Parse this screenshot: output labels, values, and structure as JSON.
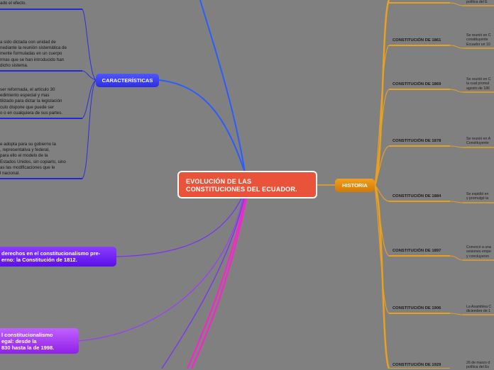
{
  "central": {
    "title": "EVOLUCIÓN DE LAS CONSTITUCIONES DEL ECUADOR."
  },
  "left": {
    "caracteristicas_label": "CARACTERÍSTICAS",
    "texts": [
      "ado el efecto.",
      "a sido dictada con unidad de\nnediante la reunión sistemática de\nmente formuladas en un cuerpo\nrmas que se han introducido han\ndicho sistema.",
      "ser reformada, el artículo 30\nedimiento especial y mas\ntilizado para dictar la legislación\nculo dispone que puede ser\no o en cualquiera de sus partes.",
      "e adopta para su gobierno la\n, representativa y federal,\npara ello el modelo de la\nEstados Unidos, sin copiarlo, sino\nas las modificaciones que le\nl nacional."
    ],
    "purple1": "derechos en el constitucionalismo pre-\nerno: la Constitución de 1812.",
    "purple2": "l constitucionalismo\negal: desde la\n830 hasta la de 1998."
  },
  "historia": {
    "label": "HISTORIA",
    "items": [
      {
        "title": "",
        "text": "política del E"
      },
      {
        "title": "CONSTITUCIÓN DE 1861",
        "text": "Se reunió en C\nconstituyente\nEcuador un 10"
      },
      {
        "title": "CONSTITUCIÓN DE 1869",
        "text": "Se reunió en C\nla cual promul\nagosto de 186"
      },
      {
        "title": "CONSTITUCIÓN DE 1878",
        "text": "Se reunió en A\nConstituyente"
      },
      {
        "title": "CONSTITUCIÓN DE 1884",
        "text": "Se expidió en\ny promulgó la"
      },
      {
        "title": "CONSTITUCIÓN DE 1897",
        "text": "Convocó a una\nsesiones empe\ny concluyeron"
      },
      {
        "title": "CONSTITUCIÓN DE 1906",
        "text": "La Asamblea C\ndiciembre de 1"
      },
      {
        "title": "CONSTITUCIÓN DE 1929",
        "text": "26 de marzo d\npolítica del Ec"
      }
    ]
  },
  "colors": {
    "background": "#808080",
    "central": "#e8533a",
    "blue": "#2b2fe0",
    "purple": "#6a1ef0",
    "magenta": "#ff1fd0",
    "orange": "#e8a020"
  }
}
